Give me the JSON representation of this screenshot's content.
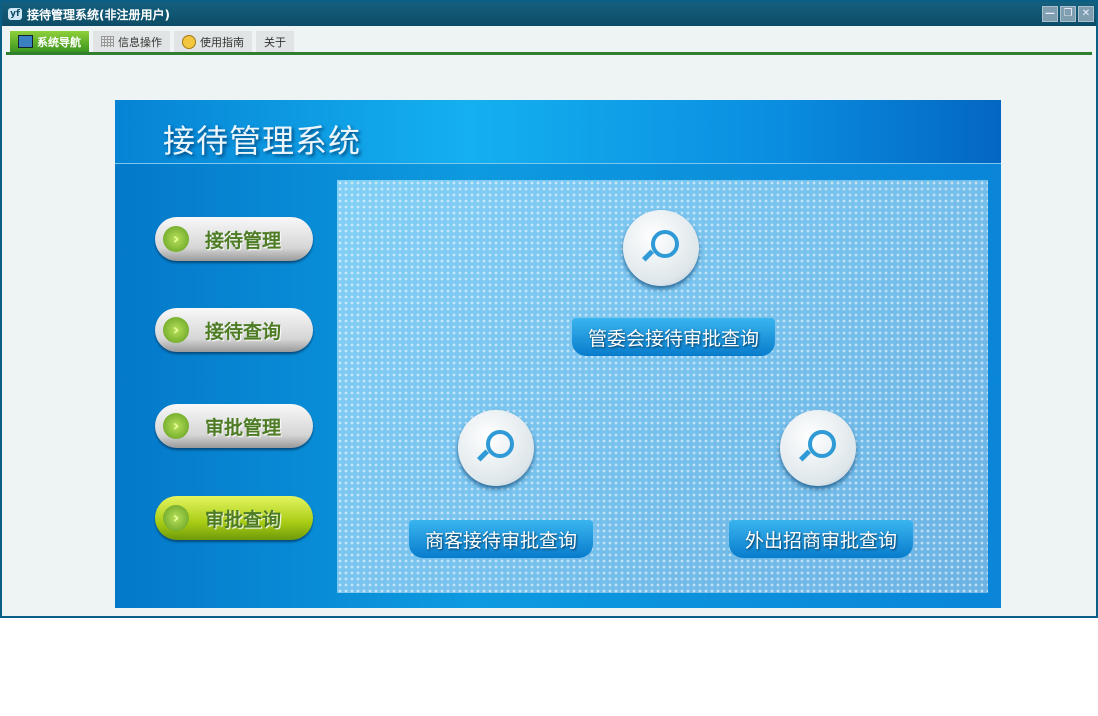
{
  "window": {
    "title": "接待管理系统(非注册用户)",
    "controls": [
      "—",
      "❐",
      "✕"
    ]
  },
  "tabs": [
    {
      "label": "系统导航",
      "active": true
    },
    {
      "label": "信息操作"
    },
    {
      "label": "使用指南"
    },
    {
      "label": "关于"
    }
  ],
  "banner": {
    "title": "接待管理系统"
  },
  "menu": [
    {
      "label": "接待管理"
    },
    {
      "label": "接待查询"
    },
    {
      "label": "审批管理"
    },
    {
      "label": "审批查询",
      "selected": true
    }
  ],
  "queries": [
    {
      "label": "管委会接待审批查询"
    },
    {
      "label": "商客接待审批查询"
    },
    {
      "label": "外出招商审批查询"
    }
  ]
}
